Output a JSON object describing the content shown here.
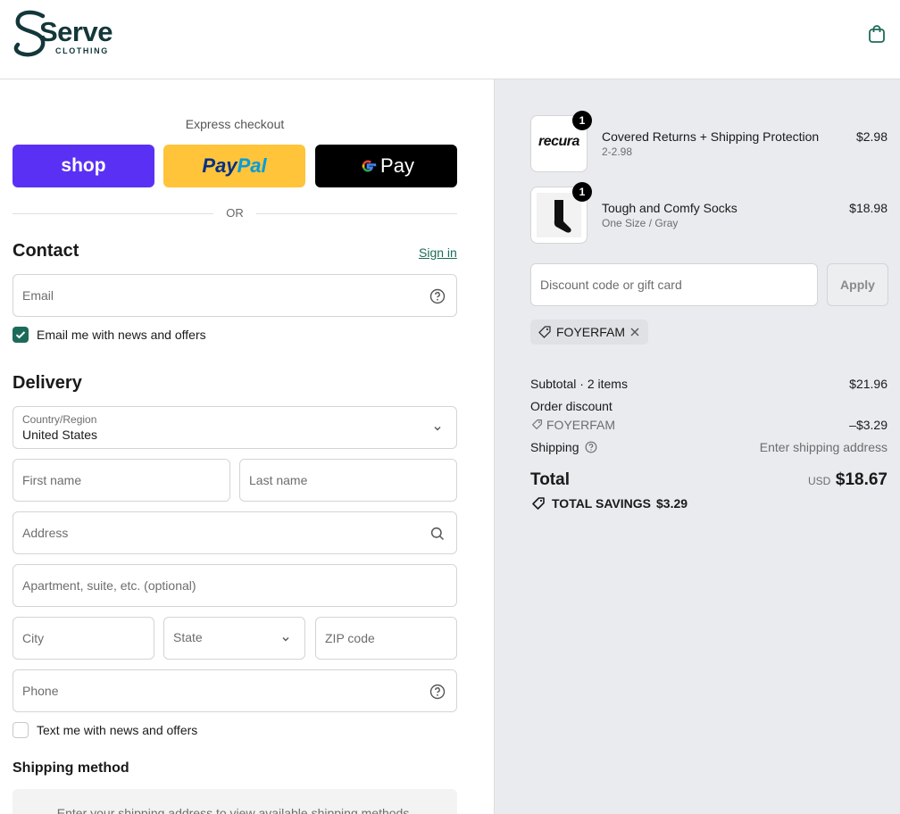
{
  "brand": {
    "name": "Serve",
    "subtitle": "CLOTHING"
  },
  "express": {
    "title": "Express checkout",
    "shop_label": "shop",
    "paypal_label_1": "Pay",
    "paypal_label_2": "Pal",
    "gpay_label": "Pay",
    "or_label": "OR"
  },
  "contact": {
    "heading": "Contact",
    "sign_in": "Sign in",
    "email_placeholder": "Email",
    "news_label": "Email me with news and offers",
    "news_checked": true
  },
  "delivery": {
    "heading": "Delivery",
    "country_label": "Country/Region",
    "country_value": "United States",
    "first_name": "First name",
    "last_name": "Last name",
    "address": "Address",
    "apartment": "Apartment, suite, etc. (optional)",
    "city": "City",
    "state": "State",
    "zip": "ZIP code",
    "phone": "Phone",
    "sms_label": "Text me with news and offers",
    "sms_checked": false
  },
  "shipping_method": {
    "heading": "Shipping method",
    "placeholder": "Enter your shipping address to view available shipping methods."
  },
  "summary": {
    "items": [
      {
        "name": "Covered Returns + Shipping Protection",
        "variant": "2-2.98",
        "price": "$2.98",
        "qty": "1",
        "thumb_text": "recura"
      },
      {
        "name": "Tough and Comfy Socks",
        "variant": "One Size / Gray",
        "price": "$18.98",
        "qty": "1"
      }
    ],
    "discount_placeholder": "Discount code or gift card",
    "apply_label": "Apply",
    "applied_code": "FOYERFAM",
    "subtotal_label": "Subtotal · 2 items",
    "subtotal_value": "$21.96",
    "order_discount_label": "Order discount",
    "discount_code": "FOYERFAM",
    "discount_value": "–$3.29",
    "shipping_label": "Shipping",
    "shipping_value": "Enter shipping address",
    "total_label": "Total",
    "currency": "USD",
    "total_value": "$18.67",
    "savings_label": "TOTAL SAVINGS",
    "savings_value": "$3.29"
  },
  "colors": {
    "accent": "#1c6b5a",
    "brand": "#13373a",
    "shop": "#5a31f4",
    "paypal": "#ffc439",
    "panel": "#e9ebee"
  }
}
